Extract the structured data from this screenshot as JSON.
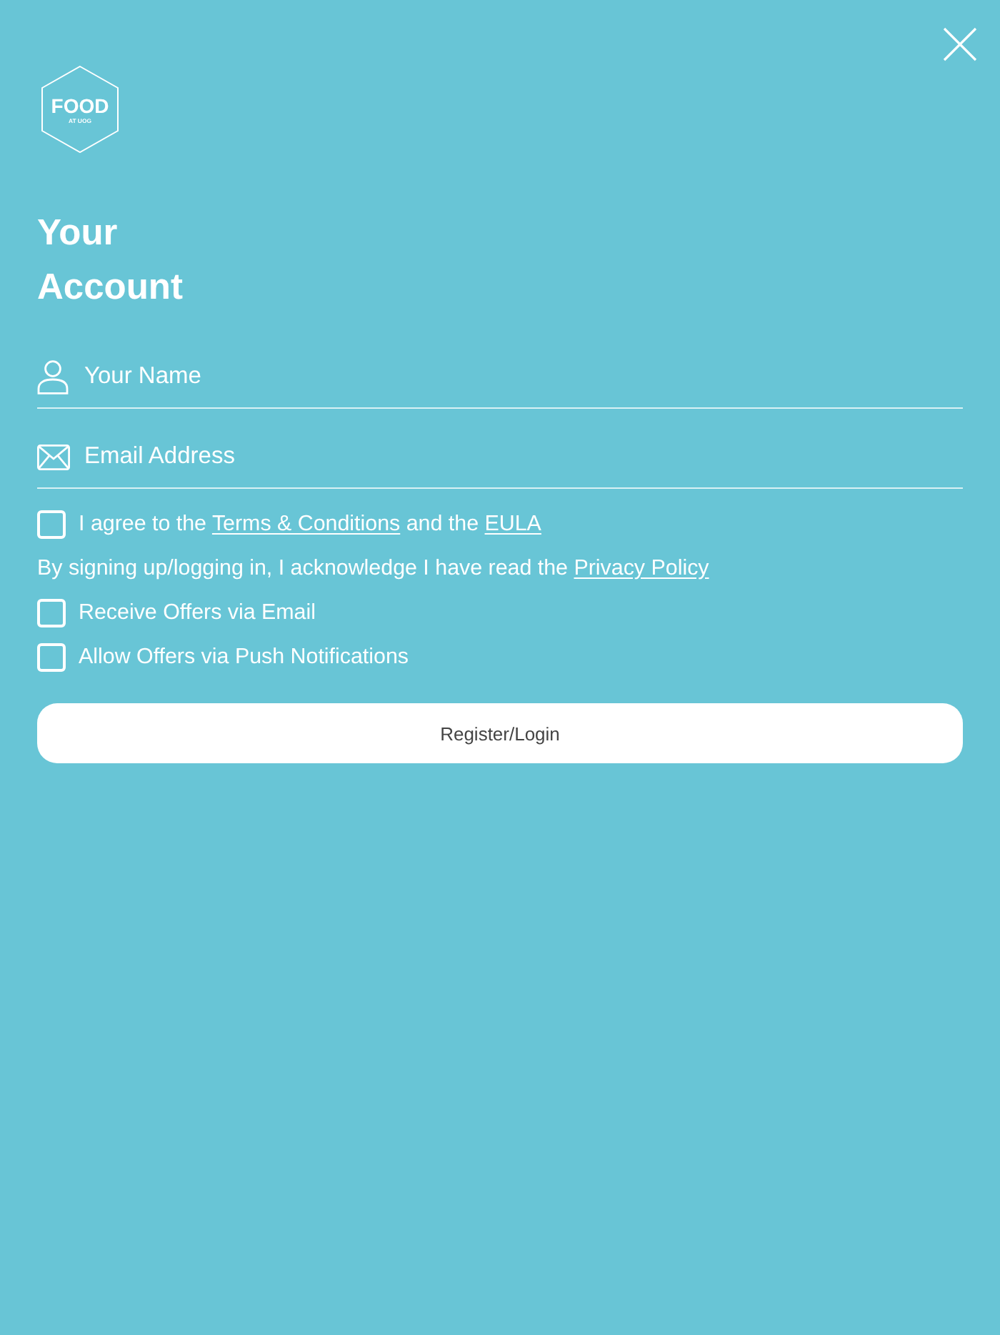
{
  "logo": {
    "title": "FOOD",
    "subtitle": "AT UOG"
  },
  "heading": "Your Account",
  "fields": [
    {
      "kind": "name",
      "placeholder": "Your Name"
    },
    {
      "kind": "email",
      "placeholder": "Email Address"
    }
  ],
  "agreement": {
    "checked": false,
    "parts": [
      {
        "kind": "text",
        "text": "I agree to the "
      },
      {
        "kind": "link",
        "text": "Terms & Conditions"
      },
      {
        "kind": "text",
        "text": " and the "
      },
      {
        "kind": "link",
        "text": "EULA"
      }
    ]
  },
  "notice": {
    "parts": [
      {
        "kind": "text",
        "text": "By signing up/logging in, I acknowledge I have read the "
      },
      {
        "kind": "link",
        "text": "Privacy Policy"
      }
    ]
  },
  "options": [
    {
      "label": "Receive Offers via Email",
      "checked": false
    },
    {
      "label": "Allow Offers via Push Notifications",
      "checked": false
    }
  ],
  "button": {
    "label": "Register/Login"
  }
}
